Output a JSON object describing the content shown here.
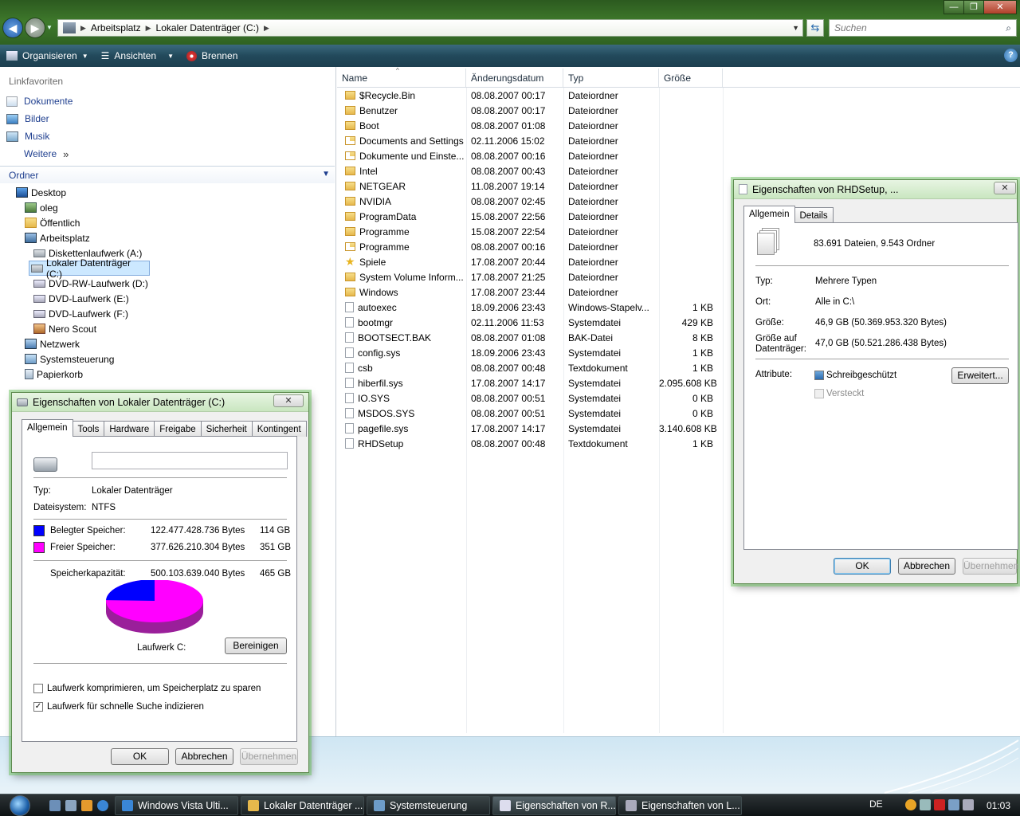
{
  "window": {
    "address": [
      "Arbeitsplatz",
      "Lokaler Datenträger (C:)"
    ],
    "search_placeholder": "Suchen",
    "controls": {
      "minimize": "—",
      "maximize": "❐",
      "close": "✕"
    }
  },
  "toolbar": {
    "organize": "Organisieren",
    "views": "Ansichten",
    "burn": "Brennen",
    "help": "?"
  },
  "sidebar": {
    "favorites_title": "Linkfavoriten",
    "favorites": [
      "Dokumente",
      "Bilder",
      "Musik"
    ],
    "more": "Weitere",
    "folders_title": "Ordner",
    "tree": [
      {
        "label": "Desktop",
        "depth": 0,
        "icon": "desktop-icon"
      },
      {
        "label": "oleg",
        "depth": 1,
        "icon": "user-folder-icon"
      },
      {
        "label": "Öffentlich",
        "depth": 1,
        "icon": "folder-icon"
      },
      {
        "label": "Arbeitsplatz",
        "depth": 1,
        "icon": "computer-icon"
      },
      {
        "label": "Diskettenlaufwerk (A:)",
        "depth": 2,
        "icon": "floppy-drive-icon"
      },
      {
        "label": "Lokaler Datenträger (C:)",
        "depth": 2,
        "icon": "hard-drive-icon",
        "selected": true
      },
      {
        "label": "DVD-RW-Laufwerk (D:)",
        "depth": 2,
        "icon": "dvd-drive-icon"
      },
      {
        "label": "DVD-Laufwerk (E:)",
        "depth": 2,
        "icon": "dvd-drive-icon"
      },
      {
        "label": "DVD-Laufwerk (F:)",
        "depth": 2,
        "icon": "dvd-drive-icon"
      },
      {
        "label": "Nero Scout",
        "depth": 2,
        "icon": "nero-scout-icon"
      },
      {
        "label": "Netzwerk",
        "depth": 1,
        "icon": "network-icon"
      },
      {
        "label": "Systemsteuerung",
        "depth": 1,
        "icon": "control-panel-icon"
      },
      {
        "label": "Papierkorb",
        "depth": 1,
        "icon": "recycle-bin-icon"
      }
    ]
  },
  "files": {
    "columns": [
      "Name",
      "Änderungsdatum",
      "Typ",
      "Größe"
    ],
    "rows": [
      {
        "name": "$Recycle.Bin",
        "date": "08.08.2007 00:17",
        "type": "Dateiordner",
        "size": "",
        "icon": "folder-icon"
      },
      {
        "name": "Benutzer",
        "date": "08.08.2007 00:17",
        "type": "Dateiordner",
        "size": "",
        "icon": "folder-icon"
      },
      {
        "name": "Boot",
        "date": "08.08.2007 01:08",
        "type": "Dateiordner",
        "size": "",
        "icon": "folder-icon"
      },
      {
        "name": "Documents and Settings",
        "date": "02.11.2006 15:02",
        "type": "Dateiordner",
        "size": "",
        "icon": "shortcut-icon"
      },
      {
        "name": "Dokumente und Einste...",
        "date": "08.08.2007 00:16",
        "type": "Dateiordner",
        "size": "",
        "icon": "shortcut-icon"
      },
      {
        "name": "Intel",
        "date": "08.08.2007 00:43",
        "type": "Dateiordner",
        "size": "",
        "icon": "folder-icon"
      },
      {
        "name": "NETGEAR",
        "date": "11.08.2007 19:14",
        "type": "Dateiordner",
        "size": "",
        "icon": "folder-icon"
      },
      {
        "name": "NVIDIA",
        "date": "08.08.2007 02:45",
        "type": "Dateiordner",
        "size": "",
        "icon": "folder-icon"
      },
      {
        "name": "ProgramData",
        "date": "15.08.2007 22:56",
        "type": "Dateiordner",
        "size": "",
        "icon": "folder-icon"
      },
      {
        "name": "Programme",
        "date": "15.08.2007 22:54",
        "type": "Dateiordner",
        "size": "",
        "icon": "folder-icon"
      },
      {
        "name": "Programme",
        "date": "08.08.2007 00:16",
        "type": "Dateiordner",
        "size": "",
        "icon": "shortcut-icon"
      },
      {
        "name": "Spiele",
        "date": "17.08.2007 20:44",
        "type": "Dateiordner",
        "size": "",
        "icon": "star-icon"
      },
      {
        "name": "System Volume Inform...",
        "date": "17.08.2007 21:25",
        "type": "Dateiordner",
        "size": "",
        "icon": "folder-icon"
      },
      {
        "name": "Windows",
        "date": "17.08.2007 23:44",
        "type": "Dateiordner",
        "size": "",
        "icon": "folder-icon"
      },
      {
        "name": "autoexec",
        "date": "18.09.2006 23:43",
        "type": "Windows-Stapelv...",
        "size": "1 KB",
        "icon": "file-icon"
      },
      {
        "name": "bootmgr",
        "date": "02.11.2006 11:53",
        "type": "Systemdatei",
        "size": "429 KB",
        "icon": "file-icon"
      },
      {
        "name": "BOOTSECT.BAK",
        "date": "08.08.2007 01:08",
        "type": "BAK-Datei",
        "size": "8 KB",
        "icon": "file-icon"
      },
      {
        "name": "config.sys",
        "date": "18.09.2006 23:43",
        "type": "Systemdatei",
        "size": "1 KB",
        "icon": "file-icon"
      },
      {
        "name": "csb",
        "date": "08.08.2007 00:48",
        "type": "Textdokument",
        "size": "1 KB",
        "icon": "file-icon"
      },
      {
        "name": "hiberfil.sys",
        "date": "17.08.2007 14:17",
        "type": "Systemdatei",
        "size": "2.095.608 KB",
        "icon": "file-icon"
      },
      {
        "name": "IO.SYS",
        "date": "08.08.2007 00:51",
        "type": "Systemdatei",
        "size": "0 KB",
        "icon": "file-icon"
      },
      {
        "name": "MSDOS.SYS",
        "date": "08.08.2007 00:51",
        "type": "Systemdatei",
        "size": "0 KB",
        "icon": "file-icon"
      },
      {
        "name": "pagefile.sys",
        "date": "17.08.2007 14:17",
        "type": "Systemdatei",
        "size": "3.140.608 KB",
        "icon": "file-icon"
      },
      {
        "name": "RHDSetup",
        "date": "08.08.2007 00:48",
        "type": "Textdokument",
        "size": "1 KB",
        "icon": "file-icon"
      }
    ]
  },
  "drive_dialog": {
    "title": "Eigenschaften von Lokaler Datenträger (C:)",
    "tabs": [
      "Allgemein",
      "Tools",
      "Hardware",
      "Freigabe",
      "Sicherheit",
      "Kontingent"
    ],
    "label_value": "",
    "type_label": "Typ:",
    "type_value": "Lokaler Datenträger",
    "fs_label": "Dateisystem:",
    "fs_value": "NTFS",
    "used_label": "Belegter Speicher:",
    "used_bytes": "122.477.428.736 Bytes",
    "used_gb": "114 GB",
    "free_label": "Freier Speicher:",
    "free_bytes": "377.626.210.304 Bytes",
    "free_gb": "351 GB",
    "capacity_label": "Speicherkapazität:",
    "capacity_bytes": "500.103.639.040 Bytes",
    "capacity_gb": "465 GB",
    "used_fraction": 0.245,
    "used_color": "#0000ff",
    "free_color": "#ff00ff",
    "drive_label": "Laufwerk C:",
    "cleanup": "Bereinigen",
    "compress": "Laufwerk komprimieren, um Speicherplatz zu sparen",
    "compress_checked": false,
    "index": "Laufwerk für schnelle Suche indizieren",
    "index_checked": true,
    "ok": "OK",
    "cancel": "Abbrechen",
    "apply": "Übernehmen",
    "close": "✕"
  },
  "file_dialog": {
    "title": "Eigenschaften von RHDSetup, ...",
    "tabs": [
      "Allgemein",
      "Details"
    ],
    "summary": "83.691 Dateien, 9.543 Ordner",
    "type_label": "Typ:",
    "type_value": "Mehrere Typen",
    "location_label": "Ort:",
    "location_value": "Alle in C:\\",
    "size_label": "Größe:",
    "size_value": "46,9 GB (50.369.953.320 Bytes)",
    "disk_size_label": "Größe auf Datenträger:",
    "disk_size_value": "47,0 GB (50.521.286.438 Bytes)",
    "attributes_label": "Attribute:",
    "readonly": "Schreibgeschützt",
    "hidden": "Versteckt",
    "advanced": "Erweitert...",
    "ok": "OK",
    "cancel": "Abbrechen",
    "apply": "Übernehmen",
    "close": "✕"
  },
  "taskbar": {
    "tasks": [
      {
        "label": "Windows Vista Ulti...",
        "icon": "ie-icon",
        "active": false
      },
      {
        "label": "Lokaler Datenträger ...",
        "icon": "explorer-folder-icon",
        "active": false
      },
      {
        "label": "Systemsteuerung",
        "icon": "control-panel-icon",
        "active": false
      },
      {
        "label": "Eigenschaften von R...",
        "icon": "properties-icon",
        "active": true
      },
      {
        "label": "Eigenschaften von L...",
        "icon": "drive-properties-icon",
        "active": false
      }
    ],
    "language": "DE",
    "clock": "01:03"
  },
  "colors": {
    "titlebar": "#3f7a2c",
    "commandbar": "#22495b",
    "link": "#1f3f8f",
    "selection": "#cce8ff"
  }
}
